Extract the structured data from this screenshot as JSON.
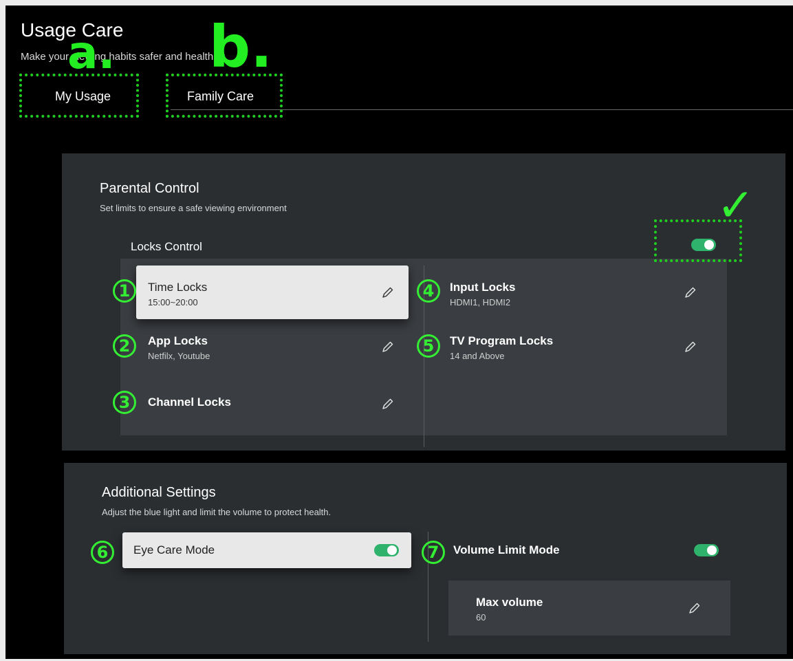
{
  "header": {
    "title": "Usage Care",
    "subtitle": "Make your viewing habits safer and healthier."
  },
  "tabs": [
    {
      "label": "My Usage"
    },
    {
      "label": "Family Care",
      "selected": true
    }
  ],
  "annotations": {
    "a": "a.",
    "b": "b.",
    "check": "✓",
    "numbers": [
      "1",
      "2",
      "3",
      "4",
      "5",
      "6",
      "7"
    ]
  },
  "parental": {
    "title": "Parental Control",
    "subtitle": "Set limits to ensure a safe viewing environment",
    "locks_label": "Locks Control",
    "locks_enabled": true,
    "items": [
      {
        "title": "Time Locks",
        "sub": "15:00~20:00",
        "focused": true
      },
      {
        "title": "App Locks",
        "sub": "Netfilx, Youtube"
      },
      {
        "title": "Channel Locks",
        "sub": ""
      },
      {
        "title": "Input Locks",
        "sub": "HDMI1, HDMI2"
      },
      {
        "title": "TV Program Locks",
        "sub": "14 and Above"
      }
    ]
  },
  "additional": {
    "title": "Additional Settings",
    "subtitle": "Adjust the blue light and limit the volume to protect health.",
    "eye_care_label": "Eye Care Mode",
    "eye_care_enabled": true,
    "volume_limit_label": "Volume Limit Mode",
    "volume_limit_enabled": true,
    "max_volume_label": "Max volume",
    "max_volume_value": "60"
  },
  "colors": {
    "background": "#000000",
    "card": "#2b2e31",
    "panel": "#3a3d41",
    "toggle_on": "#2fb36c",
    "annotation_green": "#22ee22"
  }
}
